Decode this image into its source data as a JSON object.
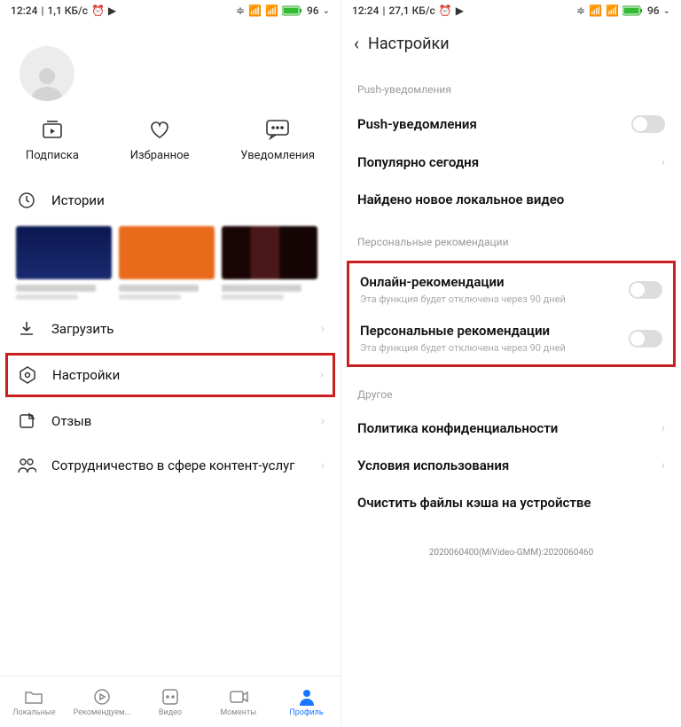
{
  "status": {
    "time": "12:24",
    "speed_left": "1,1 КБ/с",
    "speed_right": "27,1 КБ/с",
    "battery": "96"
  },
  "actions": {
    "sub": "Подписка",
    "fav": "Избранное",
    "notif": "Уведомления"
  },
  "rows": {
    "history": "Истории",
    "download": "Загрузить",
    "settings": "Настройки",
    "feedback": "Отзыв",
    "partner": "Сотрудничество в сфере контент-услуг"
  },
  "tabs": {
    "local": "Локальные",
    "rec": "Рекомендуем...",
    "video": "Видео",
    "moments": "Моменты",
    "profile": "Профиль"
  },
  "right": {
    "title": "Настройки",
    "sec1": "Push-уведомления",
    "push": "Push-уведомления",
    "popular": "Популярно сегодня",
    "found": "Найдено новое локальное видео",
    "sec2": "Персональные рекомендации",
    "online": "Онлайн-рекомендации",
    "online_sub": "Эта функция будет отключена через 90 дней",
    "personal": "Персональные рекомендации",
    "personal_sub": "Эта функция будет отключена через 90 дней",
    "sec3": "Другое",
    "privacy": "Политика конфиденциальности",
    "terms": "Условия использования",
    "cache": "Очистить файлы кэша на устройстве",
    "build": "2020060400(MiVideo-GMM):2020060460"
  }
}
